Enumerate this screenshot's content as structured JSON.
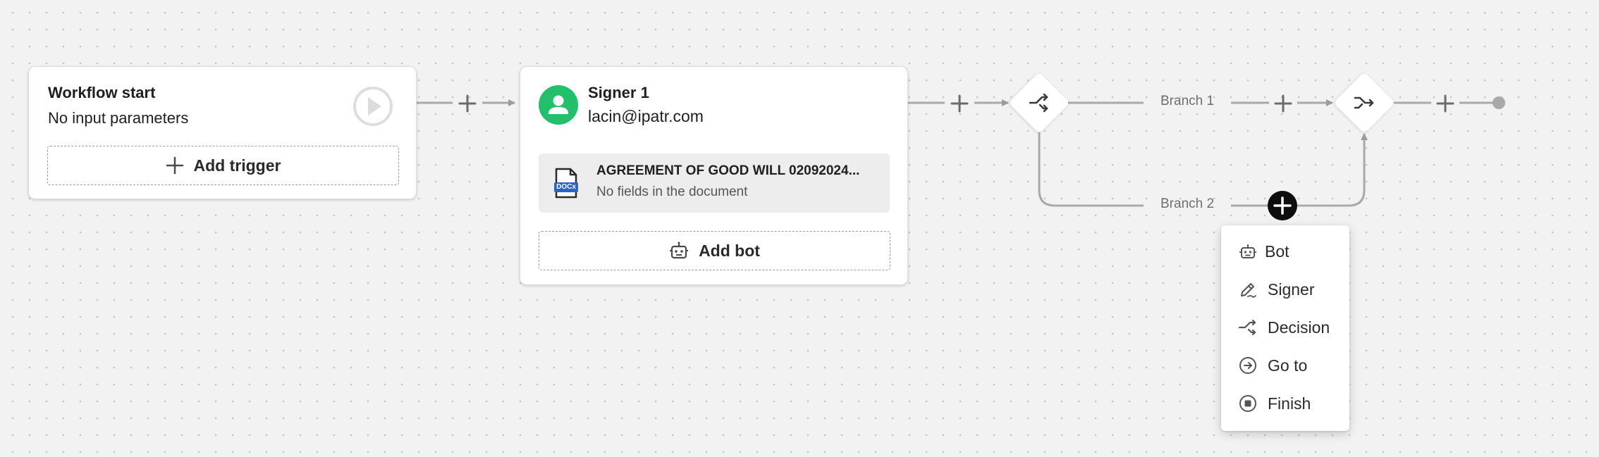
{
  "start_card": {
    "title": "Workflow start",
    "subtitle": "No input parameters",
    "add_trigger_label": "Add trigger"
  },
  "signer_card": {
    "title": "Signer 1",
    "email": "lacin@ipatr.com",
    "document": {
      "name": "AGREEMENT OF GOOD WILL 02092024...",
      "status": "No fields in the document",
      "file_badge": "DOCx"
    },
    "add_bot_label": "Add bot"
  },
  "branches": {
    "branch1_label": "Branch 1",
    "branch2_label": "Branch 2"
  },
  "add_menu": {
    "items": [
      {
        "label": "Bot",
        "icon": "bot-icon"
      },
      {
        "label": "Signer",
        "icon": "pen-icon"
      },
      {
        "label": "Decision",
        "icon": "decision-icon"
      },
      {
        "label": "Go to",
        "icon": "go-to-icon"
      },
      {
        "label": "Finish",
        "icon": "stop-icon"
      }
    ]
  },
  "colors": {
    "avatar_green": "#22c06b",
    "doc_blue": "#2b63c6",
    "connector_gray": "#a9a9a9",
    "canvas_bg": "#f2f2f2"
  }
}
